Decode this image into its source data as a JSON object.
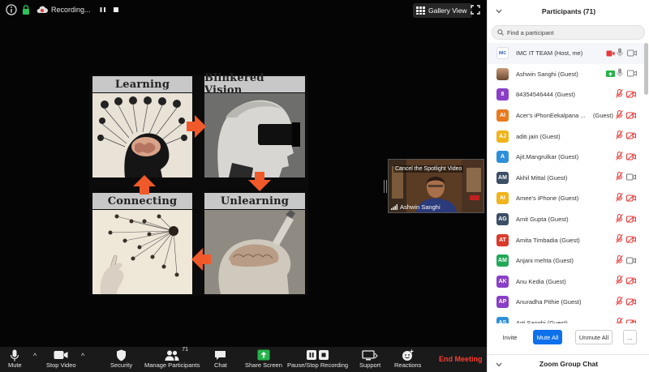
{
  "topbar": {
    "recording_label": "Recording...",
    "gallery_view_label": "Gallery View"
  },
  "slide": {
    "quadrants": [
      "Learning",
      "Blinkered Vision",
      "Connecting",
      "Unlearning"
    ]
  },
  "spotlight": {
    "cancel_label": "Cancel the Spotlight Video",
    "name": "Ashwin Sanghi"
  },
  "toolbar": {
    "mute": "Mute",
    "stop_video": "Stop Video",
    "security": "Security",
    "manage_participants": "Manage Participants",
    "participant_count": "71",
    "chat": "Chat",
    "share_screen": "Share Screen",
    "pause_stop_recording": "Pause/Stop Recording",
    "support": "Support",
    "reactions": "Reactions",
    "end_meeting": "End Meeting"
  },
  "participants_panel": {
    "title": "Participants (71)",
    "search_placeholder": "Find a participant",
    "participants": [
      {
        "initials": "IMC",
        "name": "IMC IT TEAM (Host, me)",
        "color": "#ffffff",
        "mic": "on",
        "video": "on-red"
      },
      {
        "initials": "",
        "name": "Ashwin Sanghi (Guest)",
        "color": "#8a6a50",
        "mic": "on",
        "video": "on-green"
      },
      {
        "initials": "8",
        "name": "84354546444 (Guest)",
        "color": "#8a3fc7",
        "mic": "muted",
        "video": "off"
      },
      {
        "initials": "AI",
        "name": "Acer's iPhonEekalpana ...",
        "guest": "(Guest)",
        "color": "#e87a1e",
        "mic": "muted",
        "video": "off"
      },
      {
        "initials": "AJ",
        "name": "aditi jain (Guest)",
        "color": "#f0b41c",
        "mic": "muted",
        "video": "off"
      },
      {
        "initials": "A",
        "name": "Ajit.Mangrulkar (Guest)",
        "color": "#2f8fd8",
        "mic": "muted",
        "video": "off"
      },
      {
        "initials": "AM",
        "name": "Akhil Mittal (Guest)",
        "color": "#3d4f66",
        "mic": "muted",
        "video": "on"
      },
      {
        "initials": "AI",
        "name": "Amee's iPhone (Guest)",
        "color": "#f0b41c",
        "mic": "muted",
        "video": "off"
      },
      {
        "initials": "AG",
        "name": "Amit Gupta (Guest)",
        "color": "#3d4f66",
        "mic": "muted",
        "video": "off"
      },
      {
        "initials": "AT",
        "name": "Amita Timbadia (Guest)",
        "color": "#d93a2b",
        "mic": "muted",
        "video": "off"
      },
      {
        "initials": "AM",
        "name": "Anjani mehta (Guest)",
        "color": "#23a85a",
        "mic": "muted",
        "video": "on"
      },
      {
        "initials": "AK",
        "name": "Anu Kedia (Guest)",
        "color": "#8a3fc7",
        "mic": "muted",
        "video": "off"
      },
      {
        "initials": "AP",
        "name": "Anuradha Pithie (Guest)",
        "color": "#8a3fc7",
        "mic": "muted",
        "video": "off"
      },
      {
        "initials": "AS",
        "name": "Arti Sanghi (Guest)",
        "color": "#2f8fd8",
        "mic": "muted",
        "video": "off"
      }
    ],
    "actions": {
      "invite": "Invite",
      "mute_all": "Mute All",
      "unmute_all": "Unmute All",
      "more": "..."
    },
    "chat_title": "Zoom Group Chat"
  }
}
